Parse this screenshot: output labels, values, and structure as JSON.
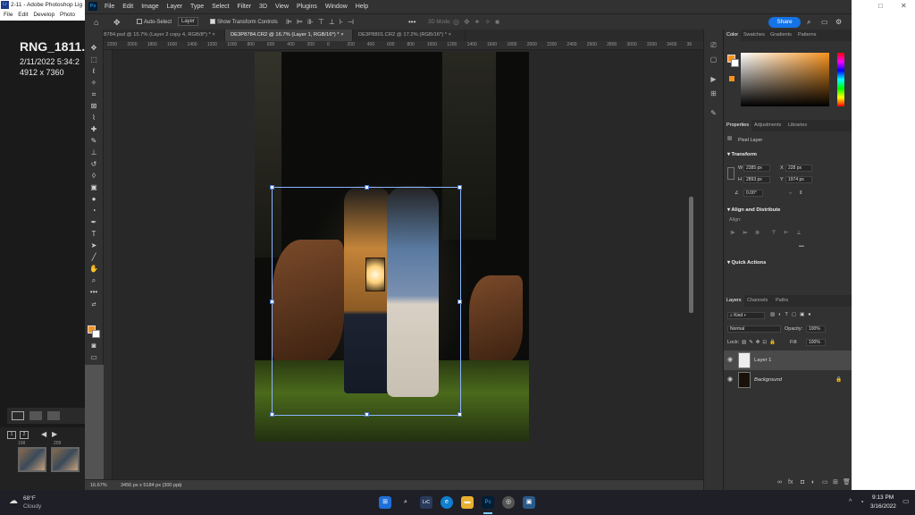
{
  "lightroom": {
    "title": "2-11 - Adobe Photoshop Lig",
    "menu": [
      "File",
      "Edit",
      "Develop",
      "Photo"
    ],
    "filename": "RNG_1811.N",
    "date": "2/11/2022 5:34:2",
    "dimensions": "4912 x 7360",
    "thumb_labels": [
      "1",
      "2"
    ],
    "strip_labels": [
      "198",
      "209"
    ]
  },
  "photoshop": {
    "app_badge": "Ps",
    "menu": [
      "File",
      "Edit",
      "Image",
      "Layer",
      "Type",
      "Select",
      "Filter",
      "3D",
      "View",
      "Plugins",
      "Window",
      "Help"
    ],
    "options": {
      "auto_select_label": "Auto-Select",
      "layer_select_value": "Layer",
      "show_transform_label": "Show Transform Controls",
      "mode_label": "3D Mode:",
      "share_label": "Share"
    },
    "tabs": [
      {
        "label": "DE3P8784.psd @ 15.7% (Layer 2 copy 4, RGB/8*) *",
        "active": false
      },
      {
        "label": "DE3P8784.CR2 @ 16.7% (Layer 1, RGB/16*) *",
        "active": true
      },
      {
        "label": "DE3P8801.CR2 @ 17.2% (RGB/16*) *",
        "active": false
      }
    ],
    "ruler_ticks": [
      "2200",
      "2000",
      "1800",
      "1600",
      "1400",
      "1200",
      "1000",
      "800",
      "600",
      "400",
      "200",
      "0",
      "200",
      "400",
      "600",
      "800",
      "1000",
      "1200",
      "1400",
      "1600",
      "1800",
      "2000",
      "2200",
      "2400",
      "2600",
      "2800",
      "3000",
      "3200",
      "3400",
      "36"
    ],
    "status": {
      "zoom": "16.67%",
      "doc_info": "3456 px x 5184 px (300 ppi)"
    },
    "foreground_color": "#f7931e",
    "background_color": "#ffffff"
  },
  "panels": {
    "color_tabs": [
      "Color",
      "Swatches",
      "Gradients",
      "Patterns"
    ],
    "properties_tabs": [
      "Properties",
      "Adjustments",
      "Libraries"
    ],
    "pixel_layer_label": "Pixel Layer",
    "transform_header": "Transform",
    "transform": {
      "w_label": "W",
      "w_value": "2385 px",
      "x_label": "X",
      "x_value": "228 px",
      "h_label": "H",
      "h_value": "2893 px",
      "y_label": "Y",
      "y_value": "1974 px",
      "angle_value": "0.00°"
    },
    "align_header": "Align and Distribute",
    "align_label": "Align:",
    "more_dots": "•••",
    "quick_actions_header": "Quick Actions",
    "layers_tabs": [
      "Layers",
      "Channels",
      "Paths"
    ],
    "kind_label": "Kind",
    "blend_mode": "Normal",
    "opacity_label": "Opacity:",
    "opacity_value": "100%",
    "lock_label": "Lock:",
    "fill_label": "Fill:",
    "fill_value": "100%",
    "layers": [
      {
        "name": "Layer 1",
        "selected": true
      },
      {
        "name": "Background",
        "selected": false
      }
    ]
  },
  "taskbar": {
    "weather_temp": "68°F",
    "weather_cond": "Cloudy",
    "time": "9:13 PM",
    "date": "3/16/2022"
  }
}
